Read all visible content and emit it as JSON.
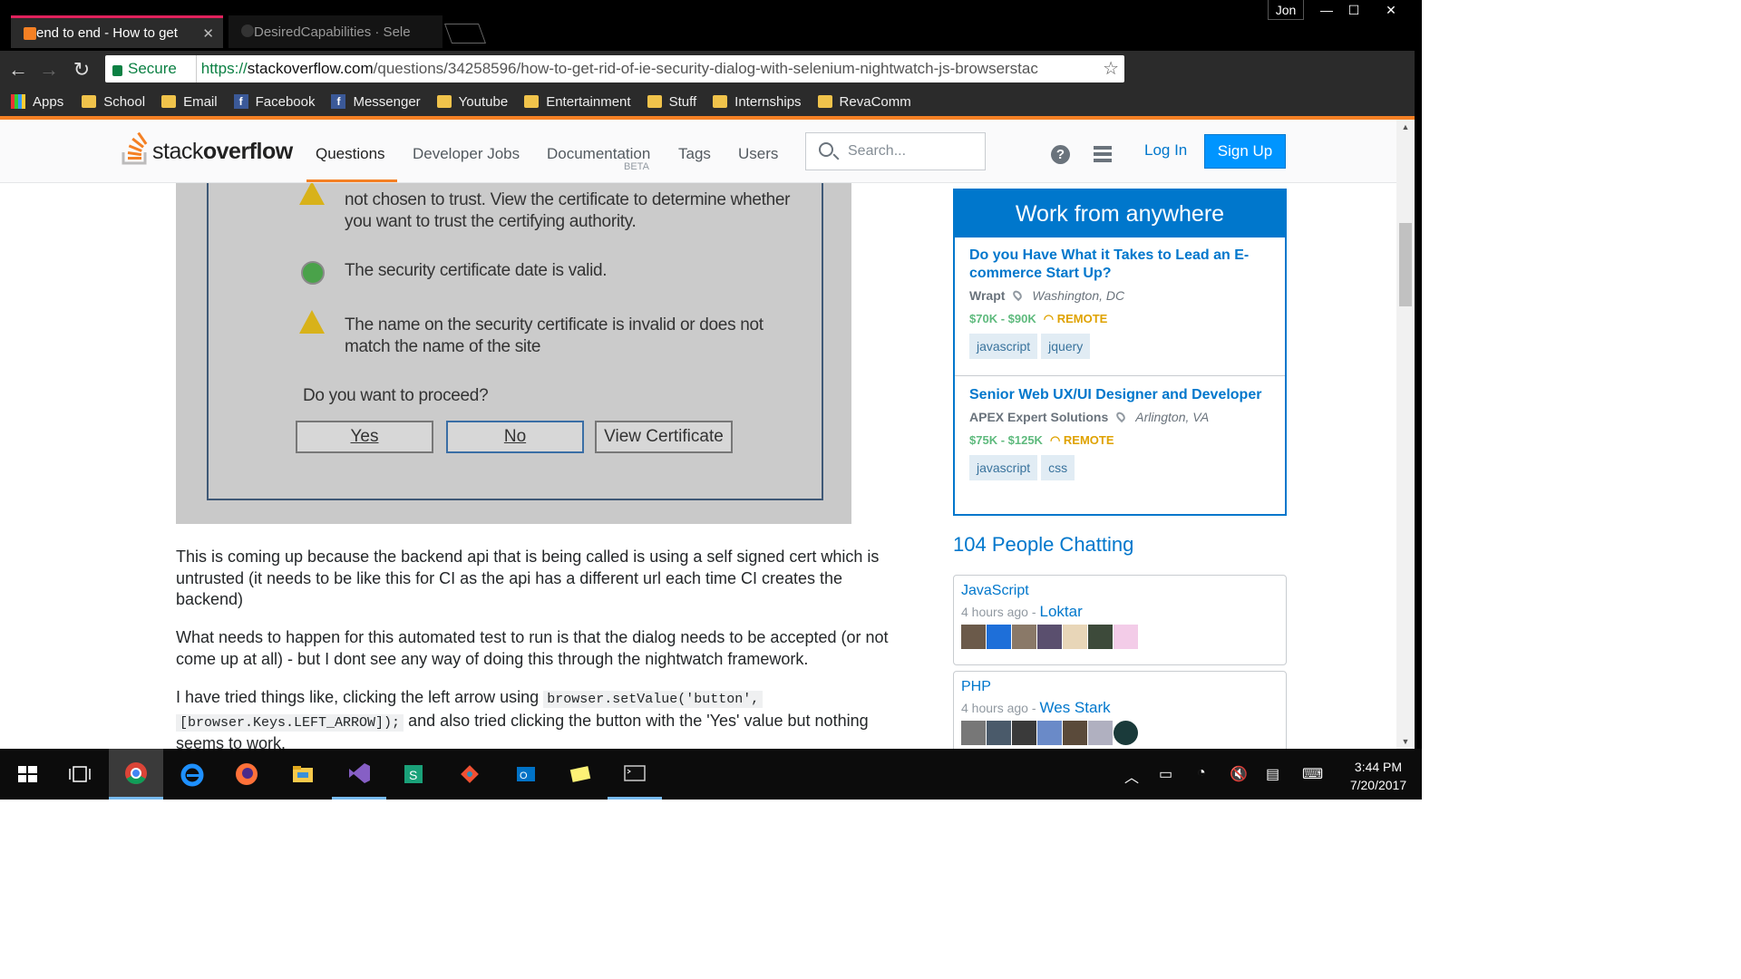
{
  "browser": {
    "tabs": [
      {
        "title": "end to end - How to get",
        "active": true
      },
      {
        "title": "DesiredCapabilities · Sele",
        "active": false
      }
    ],
    "user": "Jon",
    "window_controls": [
      "—",
      "☐",
      "✕"
    ],
    "secure_label": "Secure",
    "url_scheme": "https://",
    "url_host": "stackoverflow.com",
    "url_path": "/questions/34258596/how-to-get-rid-of-ie-security-dialog-with-selenium-nightwatch-js-browserstac",
    "bookmarks": [
      {
        "label": "Apps",
        "icon": "apps-icon"
      },
      {
        "label": "School",
        "icon": "folder-icon"
      },
      {
        "label": "Email",
        "icon": "folder-icon"
      },
      {
        "label": "Facebook",
        "icon": "facebook-icon"
      },
      {
        "label": "Messenger",
        "icon": "facebook-icon"
      },
      {
        "label": "Youtube",
        "icon": "folder-icon"
      },
      {
        "label": "Entertainment",
        "icon": "folder-icon"
      },
      {
        "label": "Stuff",
        "icon": "folder-icon"
      },
      {
        "label": "Internships",
        "icon": "folder-icon"
      },
      {
        "label": "RevaComm",
        "icon": "folder-icon"
      }
    ]
  },
  "so_header": {
    "logo_light": "stack",
    "logo_bold": "overflow",
    "nav": {
      "questions": "Questions",
      "jobs": "Developer Jobs",
      "documentation": "Documentation",
      "documentation_badge": "BETA",
      "tags": "Tags",
      "users": "Users"
    },
    "search_placeholder": "Search...",
    "login": "Log In",
    "signup": "Sign Up",
    "accent": "#f48024"
  },
  "dialog_screenshot": {
    "line_top": "not chosen to trust. View the certificate to determine whether",
    "line_top2": "you want to trust the certifying authority.",
    "valid_text": "The security certificate date is valid.",
    "invalid_text1": "The name on the security certificate is invalid or does not",
    "invalid_text2": "match the name of the site",
    "question": "Do you want to proceed?",
    "buttons": [
      "Yes",
      "No",
      "View Certificate"
    ]
  },
  "post": {
    "p1": "This is coming up because the backend api that is being called is using a self signed cert which is untrusted (it needs to be like this for CI as the api has a different url each time CI creates the backend)",
    "p2": "What needs to happen for this automated test to run is that the dialog needs to be accepted (or not come up at all) - but I dont see any way of doing this through the nightwatch framework.",
    "p3_a": "I have tried things like, clicking the left arrow using",
    "p3_code1": "browser.setValue('button',",
    "p3_code2": "[browser.Keys.LEFT_ARROW]);",
    "p3_b": "and also tried clicking the button with the 'Yes' value but nothing",
    "p3_c": "seems to work."
  },
  "jobs": {
    "header": "Work from anywhere",
    "items": [
      {
        "title": "Do you Have What it Takes to Lead an E-commerce Start Up?",
        "company": "Wrapt",
        "location": "Washington, DC",
        "salary": "$70K - $90K",
        "remote": "REMOTE",
        "tags": [
          "javascript",
          "jquery"
        ]
      },
      {
        "title": "Senior Web UX/UI Designer and Developer",
        "company": "APEX Expert Solutions",
        "location": "Arlington, VA",
        "salary": "$75K - $125K",
        "remote": "REMOTE",
        "tags": [
          "javascript",
          "css"
        ]
      }
    ]
  },
  "chat": {
    "heading": "104 People Chatting",
    "rooms": [
      {
        "name": "JavaScript",
        "time": "4 hours ago",
        "sep": "-",
        "user": "Loktar"
      },
      {
        "name": "PHP",
        "time": "4 hours ago",
        "sep": "-",
        "user": "Wes Stark"
      }
    ]
  },
  "taskbar": {
    "time": "3:44 PM",
    "date": "7/20/2017"
  }
}
